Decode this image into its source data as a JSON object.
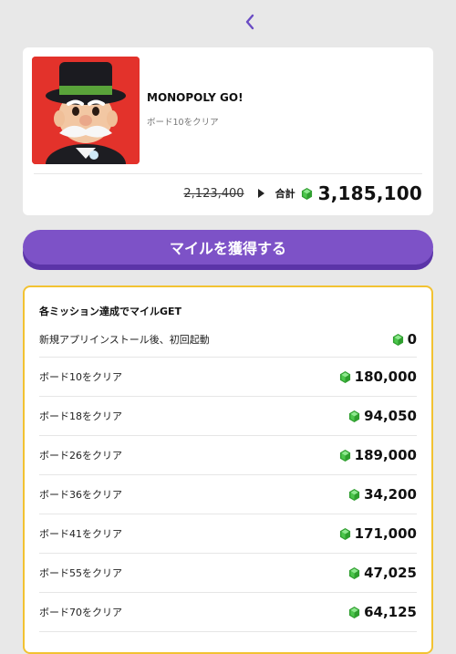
{
  "header": {
    "back_icon": "chevron-left-icon"
  },
  "app": {
    "title": "MONOPOLY GO!",
    "subtitle": "ボード10をクリア",
    "old_price": "2,123,400",
    "total_label": "合計",
    "total_value": "3,185,100"
  },
  "cta": {
    "label": "マイルを獲得する"
  },
  "missions": {
    "title": "各ミッション達成でマイルGET",
    "items": [
      {
        "label": "新規アプリインストール後、初回起動",
        "value": "0"
      },
      {
        "label": "ボード10をクリア",
        "value": "180,000"
      },
      {
        "label": "ボード18をクリア",
        "value": "94,050"
      },
      {
        "label": "ボード26をクリア",
        "value": "189,000"
      },
      {
        "label": "ボード36をクリア",
        "value": "34,200"
      },
      {
        "label": "ボード41をクリア",
        "value": "171,000"
      },
      {
        "label": "ボード55をクリア",
        "value": "47,025"
      },
      {
        "label": "ボード70をクリア",
        "value": "64,125"
      }
    ]
  },
  "colors": {
    "accent": "#7d52c7",
    "border": "#f2c232",
    "gem": "#3fbf3f"
  }
}
